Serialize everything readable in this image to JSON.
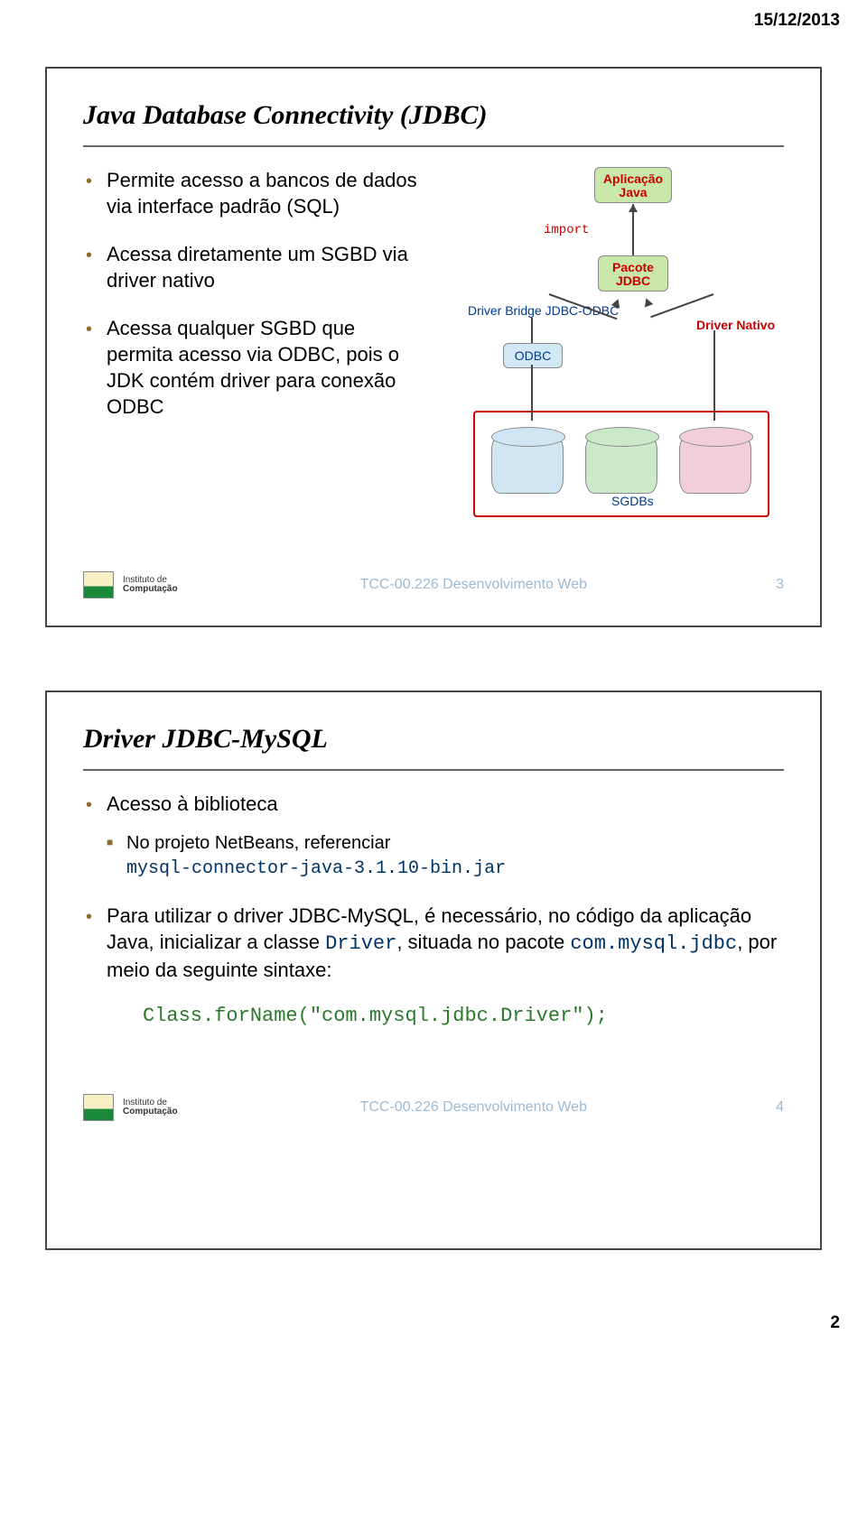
{
  "page": {
    "date": "15/12/2013",
    "number": "2"
  },
  "footer": {
    "logo_small": "Instituto de",
    "logo_big": "Computação",
    "course": "TCC-00.226 Desenvolvimento Web"
  },
  "slide1": {
    "title": "Java Database Connectivity (JDBC)",
    "bullets": [
      "Permite acesso a bancos de dados via interface padrão (SQL)",
      "Acessa diretamente um SGBD via driver nativo",
      "Acessa qualquer SGBD que permita acesso via ODBC, pois o JDK contém driver para conexão ODBC"
    ],
    "slide_no": "3",
    "diagram": {
      "app": "Aplicação Java",
      "import_kw": "import",
      "pkg": "Pacote JDBC",
      "bridge": "Driver Bridge JDBC-ODBC",
      "odbc": "ODBC",
      "native": "Driver Nativo",
      "sgdbs": "SGDBs"
    }
  },
  "slide2": {
    "title": "Driver JDBC-MySQL",
    "b1": "Acesso à biblioteca",
    "sub_prefix": "No projeto NetBeans, referenciar",
    "sub_code": "mysql-connector-java-3.1.10-bin.jar",
    "b2_pre": "Para utilizar o driver JDBC-MySQL, é necessário, no código da aplicação Java, inicializar a classe ",
    "b2_code1": "Driver",
    "b2_mid": ", situada no pacote ",
    "b2_code2": "com.mysql.jdbc",
    "b2_post": ", por meio da seguinte sintaxe:",
    "code_line": "Class.forName(\"com.mysql.jdbc.Driver\");",
    "slide_no": "4"
  }
}
